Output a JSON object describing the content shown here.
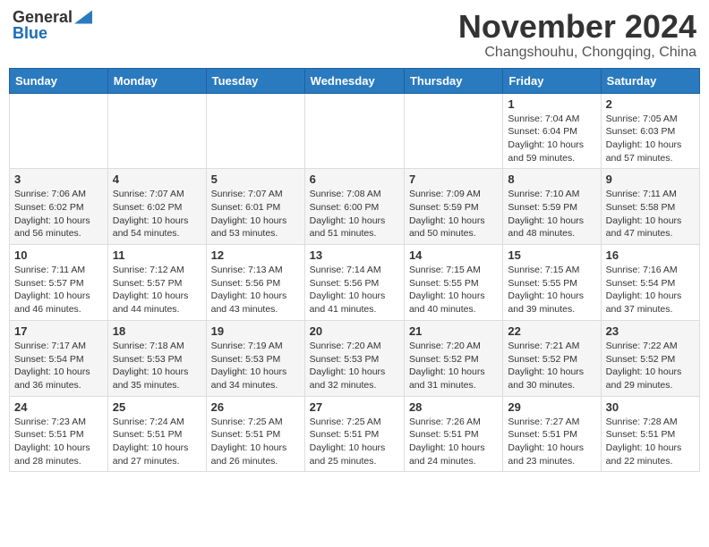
{
  "header": {
    "logo_general": "General",
    "logo_blue": "Blue",
    "month_title": "November 2024",
    "subtitle": "Changshouhu, Chongqing, China"
  },
  "weekdays": [
    "Sunday",
    "Monday",
    "Tuesday",
    "Wednesday",
    "Thursday",
    "Friday",
    "Saturday"
  ],
  "weeks": [
    [
      {
        "day": "",
        "info": ""
      },
      {
        "day": "",
        "info": ""
      },
      {
        "day": "",
        "info": ""
      },
      {
        "day": "",
        "info": ""
      },
      {
        "day": "",
        "info": ""
      },
      {
        "day": "1",
        "info": "Sunrise: 7:04 AM\nSunset: 6:04 PM\nDaylight: 10 hours and 59 minutes."
      },
      {
        "day": "2",
        "info": "Sunrise: 7:05 AM\nSunset: 6:03 PM\nDaylight: 10 hours and 57 minutes."
      }
    ],
    [
      {
        "day": "3",
        "info": "Sunrise: 7:06 AM\nSunset: 6:02 PM\nDaylight: 10 hours and 56 minutes."
      },
      {
        "day": "4",
        "info": "Sunrise: 7:07 AM\nSunset: 6:02 PM\nDaylight: 10 hours and 54 minutes."
      },
      {
        "day": "5",
        "info": "Sunrise: 7:07 AM\nSunset: 6:01 PM\nDaylight: 10 hours and 53 minutes."
      },
      {
        "day": "6",
        "info": "Sunrise: 7:08 AM\nSunset: 6:00 PM\nDaylight: 10 hours and 51 minutes."
      },
      {
        "day": "7",
        "info": "Sunrise: 7:09 AM\nSunset: 5:59 PM\nDaylight: 10 hours and 50 minutes."
      },
      {
        "day": "8",
        "info": "Sunrise: 7:10 AM\nSunset: 5:59 PM\nDaylight: 10 hours and 48 minutes."
      },
      {
        "day": "9",
        "info": "Sunrise: 7:11 AM\nSunset: 5:58 PM\nDaylight: 10 hours and 47 minutes."
      }
    ],
    [
      {
        "day": "10",
        "info": "Sunrise: 7:11 AM\nSunset: 5:57 PM\nDaylight: 10 hours and 46 minutes."
      },
      {
        "day": "11",
        "info": "Sunrise: 7:12 AM\nSunset: 5:57 PM\nDaylight: 10 hours and 44 minutes."
      },
      {
        "day": "12",
        "info": "Sunrise: 7:13 AM\nSunset: 5:56 PM\nDaylight: 10 hours and 43 minutes."
      },
      {
        "day": "13",
        "info": "Sunrise: 7:14 AM\nSunset: 5:56 PM\nDaylight: 10 hours and 41 minutes."
      },
      {
        "day": "14",
        "info": "Sunrise: 7:15 AM\nSunset: 5:55 PM\nDaylight: 10 hours and 40 minutes."
      },
      {
        "day": "15",
        "info": "Sunrise: 7:15 AM\nSunset: 5:55 PM\nDaylight: 10 hours and 39 minutes."
      },
      {
        "day": "16",
        "info": "Sunrise: 7:16 AM\nSunset: 5:54 PM\nDaylight: 10 hours and 37 minutes."
      }
    ],
    [
      {
        "day": "17",
        "info": "Sunrise: 7:17 AM\nSunset: 5:54 PM\nDaylight: 10 hours and 36 minutes."
      },
      {
        "day": "18",
        "info": "Sunrise: 7:18 AM\nSunset: 5:53 PM\nDaylight: 10 hours and 35 minutes."
      },
      {
        "day": "19",
        "info": "Sunrise: 7:19 AM\nSunset: 5:53 PM\nDaylight: 10 hours and 34 minutes."
      },
      {
        "day": "20",
        "info": "Sunrise: 7:20 AM\nSunset: 5:53 PM\nDaylight: 10 hours and 32 minutes."
      },
      {
        "day": "21",
        "info": "Sunrise: 7:20 AM\nSunset: 5:52 PM\nDaylight: 10 hours and 31 minutes."
      },
      {
        "day": "22",
        "info": "Sunrise: 7:21 AM\nSunset: 5:52 PM\nDaylight: 10 hours and 30 minutes."
      },
      {
        "day": "23",
        "info": "Sunrise: 7:22 AM\nSunset: 5:52 PM\nDaylight: 10 hours and 29 minutes."
      }
    ],
    [
      {
        "day": "24",
        "info": "Sunrise: 7:23 AM\nSunset: 5:51 PM\nDaylight: 10 hours and 28 minutes."
      },
      {
        "day": "25",
        "info": "Sunrise: 7:24 AM\nSunset: 5:51 PM\nDaylight: 10 hours and 27 minutes."
      },
      {
        "day": "26",
        "info": "Sunrise: 7:25 AM\nSunset: 5:51 PM\nDaylight: 10 hours and 26 minutes."
      },
      {
        "day": "27",
        "info": "Sunrise: 7:25 AM\nSunset: 5:51 PM\nDaylight: 10 hours and 25 minutes."
      },
      {
        "day": "28",
        "info": "Sunrise: 7:26 AM\nSunset: 5:51 PM\nDaylight: 10 hours and 24 minutes."
      },
      {
        "day": "29",
        "info": "Sunrise: 7:27 AM\nSunset: 5:51 PM\nDaylight: 10 hours and 23 minutes."
      },
      {
        "day": "30",
        "info": "Sunrise: 7:28 AM\nSunset: 5:51 PM\nDaylight: 10 hours and 22 minutes."
      }
    ]
  ]
}
